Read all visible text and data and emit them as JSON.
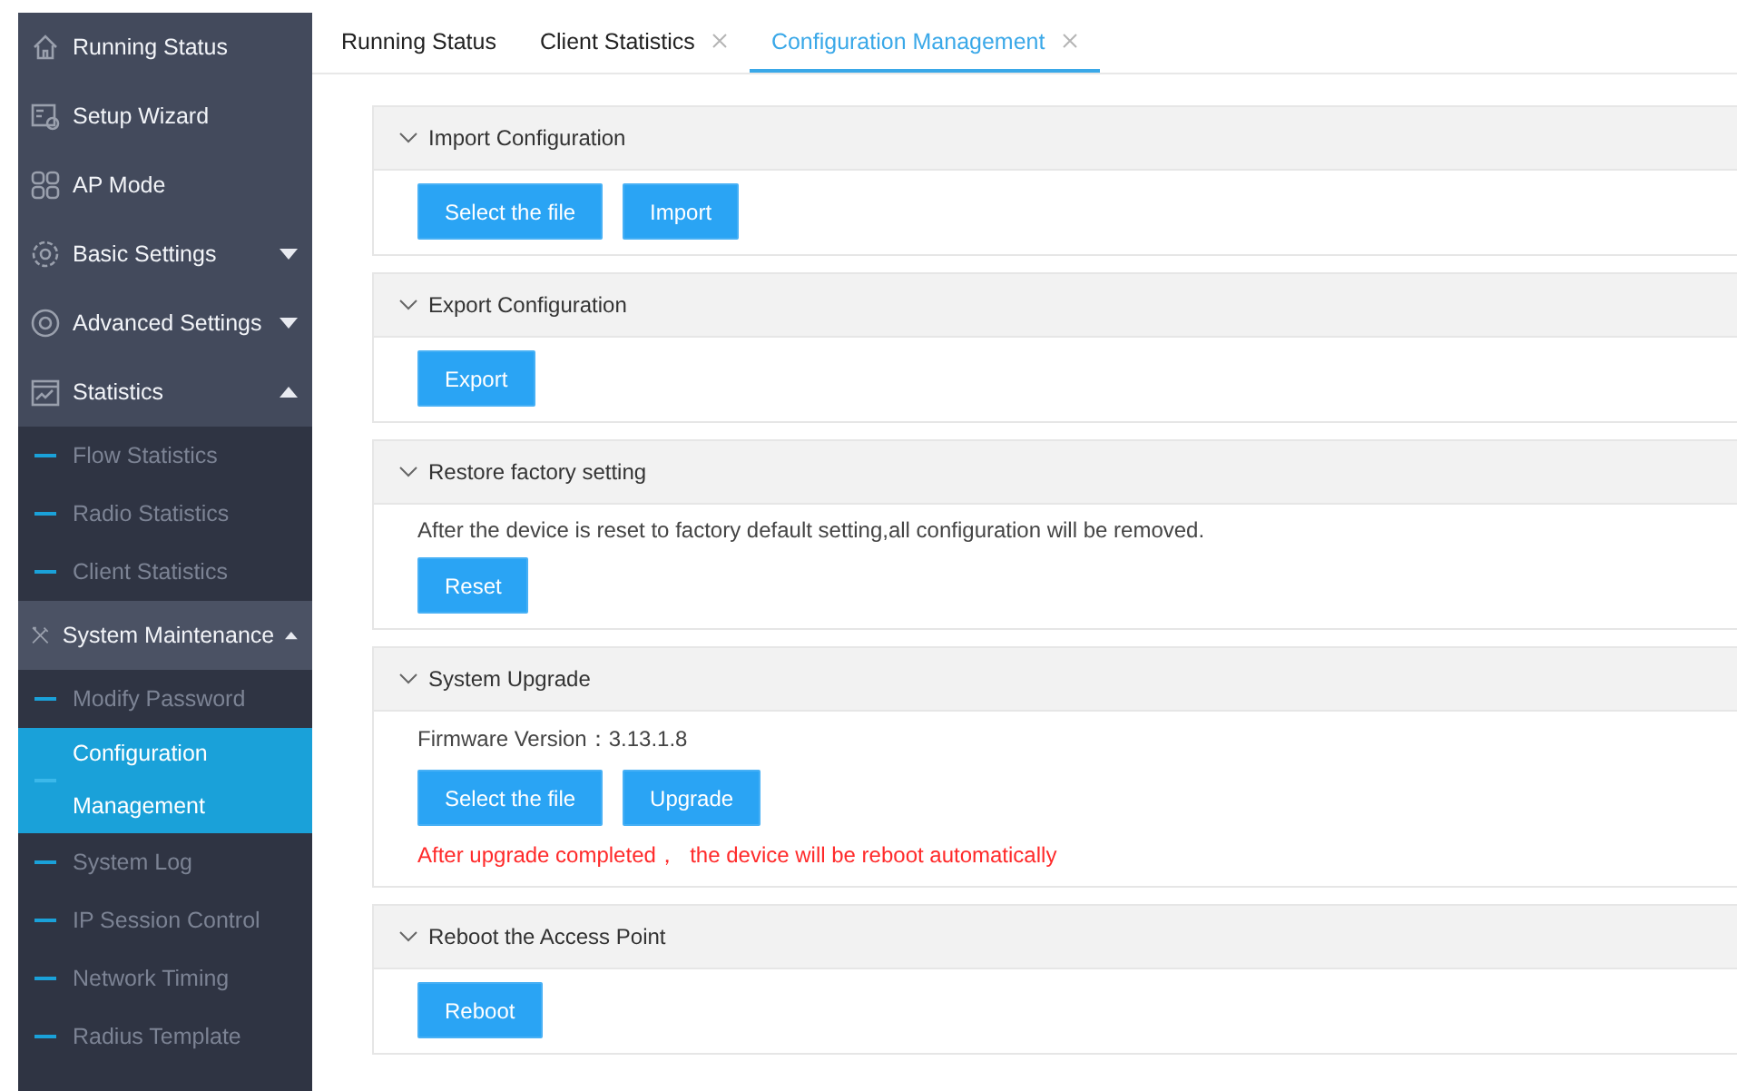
{
  "sidebar": {
    "items": [
      {
        "label": "Running Status"
      },
      {
        "label": "Setup Wizard"
      },
      {
        "label": "AP Mode"
      },
      {
        "label": "Basic Settings",
        "expanded": false
      },
      {
        "label": "Advanced Settings",
        "expanded": false
      },
      {
        "label": "Statistics",
        "expanded": true,
        "children": [
          {
            "label": "Flow Statistics",
            "selected": false
          },
          {
            "label": "Radio Statistics",
            "selected": false
          },
          {
            "label": "Client Statistics",
            "selected": false
          }
        ]
      },
      {
        "label": "System Maintenance",
        "expanded": true,
        "children": [
          {
            "label": "Modify Password",
            "selected": false
          },
          {
            "label": "Configuration Management",
            "selected": true
          },
          {
            "label": "System Log",
            "selected": false
          },
          {
            "label": "IP Session Control",
            "selected": false
          },
          {
            "label": "Network Timing",
            "selected": false
          },
          {
            "label": "Radius Template",
            "selected": false
          }
        ]
      }
    ]
  },
  "tabs": [
    {
      "label": "Running Status",
      "selected": false,
      "closable": false
    },
    {
      "label": "Client Statistics",
      "selected": false,
      "closable": true
    },
    {
      "label": "Configuration Management",
      "selected": true,
      "closable": true
    }
  ],
  "sections": [
    {
      "title": "Import Configuration",
      "rows": [
        {
          "kind": "buttons",
          "buttons": [
            "Select the file",
            "Import"
          ]
        }
      ]
    },
    {
      "title": "Export Configuration",
      "rows": [
        {
          "kind": "buttons",
          "buttons": [
            "Export"
          ]
        }
      ]
    },
    {
      "title": "Restore factory setting",
      "rows": [
        {
          "kind": "text",
          "text": "After the device is reset to factory default setting,all configuration will be removed."
        },
        {
          "kind": "buttons",
          "buttons": [
            "Reset"
          ]
        }
      ]
    },
    {
      "title": "System Upgrade",
      "rows": [
        {
          "kind": "text",
          "text": "Firmware Version：3.13.1.8"
        },
        {
          "kind": "buttons",
          "buttons": [
            "Select the file",
            "Upgrade"
          ]
        },
        {
          "kind": "warning",
          "text": "After upgrade completed，  the device will be reboot automatically"
        }
      ]
    },
    {
      "title": "Reboot the Access Point",
      "rows": [
        {
          "kind": "buttons",
          "buttons": [
            "Reboot"
          ]
        }
      ]
    }
  ]
}
